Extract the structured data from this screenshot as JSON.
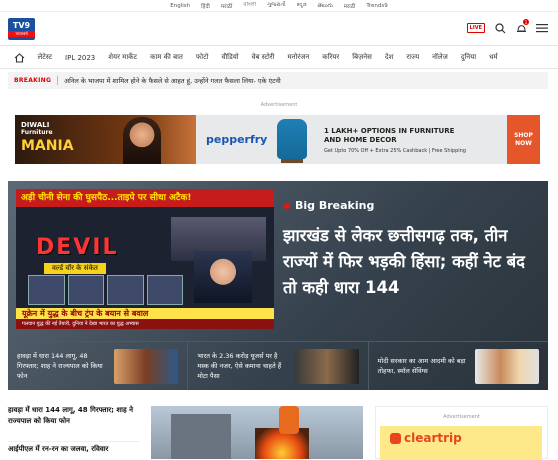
{
  "languages": [
    "English",
    "हिंदी",
    "मराठी",
    "বাংলা",
    "ગુજરાતી",
    "ಕನ್ನಡ",
    "తెలుగు",
    "मराठी",
    "Trends9"
  ],
  "logo": {
    "brand": "TV9",
    "sub": "भारतवर्ष"
  },
  "header_icons": {
    "live": "LIVE",
    "notification_count": "1"
  },
  "nav": [
    "लेटेस्ट",
    "IPL 2023",
    "शेयर मार्केट",
    "काम की बात",
    "फोटो",
    "वीडियो",
    "वेब स्टोरी",
    "मनोरंजन",
    "करियर",
    "बिज़नेस",
    "देश",
    "राज्य",
    "नॉलेज",
    "दुनिया",
    "धर्म"
  ],
  "breaking": {
    "tag": "BREAKING",
    "text": "अनिल के भाजपा में शामिल होने के फैसले से आहत हूं, उन्होंने गलत फैसला लिया- एके एंटनी"
  },
  "ad_label": "Advertisement",
  "banner": {
    "left_line1": "DIWALI",
    "left_line2": "Furniture",
    "left_line3": "MANIA",
    "brand": "pepperfry",
    "offer_line1": "1 LAKH+ OPTIONS IN FURNITURE",
    "offer_line2": "AND HOME DECOR",
    "offer_small": "Get Upto 70% Off + Extra 25% Cashback | Free Shipping",
    "cta": "SHOP NOW"
  },
  "hero": {
    "tv_top": "अड़ी चीनी सेना की घुसपैठ...ताइपे पर सीधा अटैक!",
    "tv_title": "DEVIL",
    "tv_tag": "वर्ल्ड वॉर के संकेत",
    "tv_ticker": "यूक्रेन में युद्ध के बीच ट्रंप के बयान से बवाल",
    "tv_bottom": "गलवान युद्ध की नई तैयारी, दुनिया ने देखा भारत का युद्ध अभ्यास",
    "label": "Big Breaking",
    "headline": "झारखंड से लेकर छत्तीसगढ़ तक, तीन राज्यों में फिर भड़की हिंसा; कहीं नेट बंद तो कही धारा 144",
    "cards": [
      {
        "text": "हावड़ा में धारा 144 लागू, 48 गिरफ्तार; शाह ने राज्यपाल को किया फोन"
      },
      {
        "text": "भारत के 2.36 करोड़ यूजर्स पर है मस्क की नजर, ऐसे कमाना चाहते हैं मोटा पैसा"
      },
      {
        "text": "मोदी सरकार का आम आदमी को बड़ा तोहफा, स्मॉल सेविंग्स"
      }
    ]
  },
  "lower": {
    "story1": "हावड़ा में धारा 144 लागू, 48 गिरफ्तार; शाह ने राज्यपाल को किया फोन",
    "story2": "आईपीएल में रन-रन का जलवा, रविवार"
  },
  "right_ad": {
    "label": "Advertisement",
    "brand": "cleartrip"
  }
}
